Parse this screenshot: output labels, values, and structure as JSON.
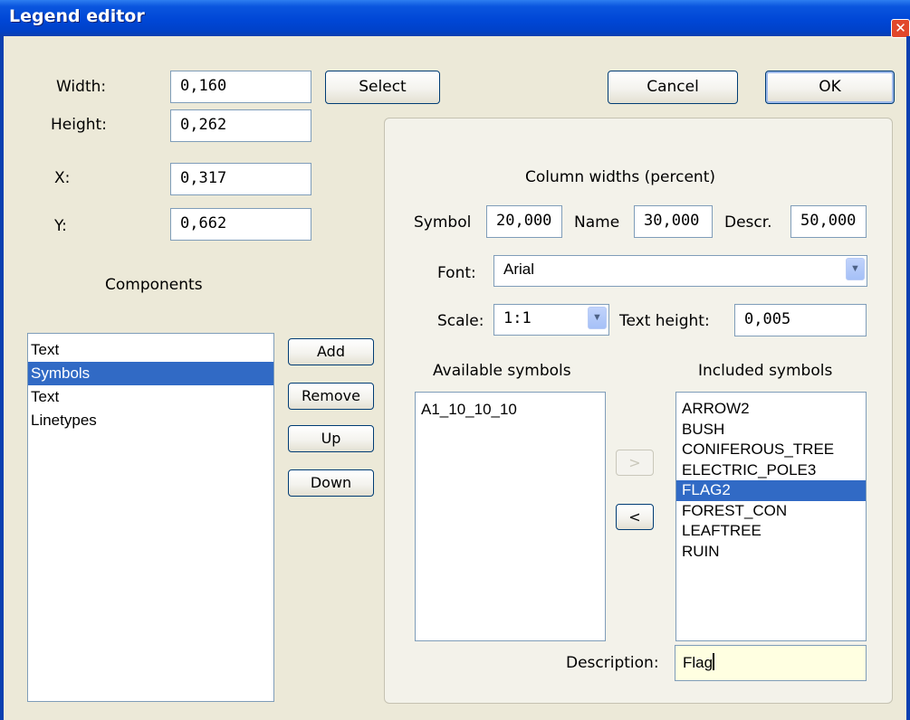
{
  "window": {
    "title": "Legend editor"
  },
  "fields": {
    "width": {
      "label": "Width:",
      "value": "0,160"
    },
    "height": {
      "label": "Height:",
      "value": "0,262"
    },
    "x": {
      "label": "X:",
      "value": "0,317"
    },
    "y": {
      "label": "Y:",
      "value": "0,662"
    }
  },
  "buttons": {
    "select": "Select",
    "cancel": "Cancel",
    "ok": "OK"
  },
  "components": {
    "label": "Components",
    "items": [
      {
        "label": "Text",
        "selected": false
      },
      {
        "label": "Symbols",
        "selected": true
      },
      {
        "label": "Text",
        "selected": false
      },
      {
        "label": "Linetypes",
        "selected": false
      }
    ],
    "buttons": {
      "add": "Add",
      "remove": "Remove",
      "up": "Up",
      "down": "Down"
    }
  },
  "symbols_panel": {
    "column_widths_label": "Column widths (percent)",
    "symbol_label": "Symbol",
    "symbol_value": "20,000",
    "name_label": "Name",
    "name_value": "30,000",
    "descr_label": "Descr.",
    "descr_value": "50,000",
    "font_label": "Font:",
    "font_value": "Arial",
    "scale_label": "Scale:",
    "scale_value": "1:1",
    "text_height_label": "Text height:",
    "text_height_value": "0,005",
    "available_label": "Available symbols",
    "available": [
      "A1_10_10_10"
    ],
    "included_label": "Included symbols",
    "included": [
      {
        "label": "ARROW2",
        "selected": false
      },
      {
        "label": "BUSH",
        "selected": false
      },
      {
        "label": "CONIFEROUS_TREE",
        "selected": false
      },
      {
        "label": "ELECTRIC_POLE3",
        "selected": false
      },
      {
        "label": "FLAG2",
        "selected": true
      },
      {
        "label": "FOREST_CON",
        "selected": false
      },
      {
        "label": "LEAFTREE",
        "selected": false
      },
      {
        "label": "RUIN",
        "selected": false
      }
    ],
    "move_right": ">",
    "move_left": "<",
    "description_label": "Description:",
    "description_value": "Flag"
  },
  "icons": {
    "close": "close-icon",
    "dropdown": "chevron-down-icon"
  },
  "colors": {
    "titlebar": "#0047D6",
    "selection": "#316AC5",
    "dialog_bg": "#ECE9D8",
    "close": "#E1472B"
  }
}
